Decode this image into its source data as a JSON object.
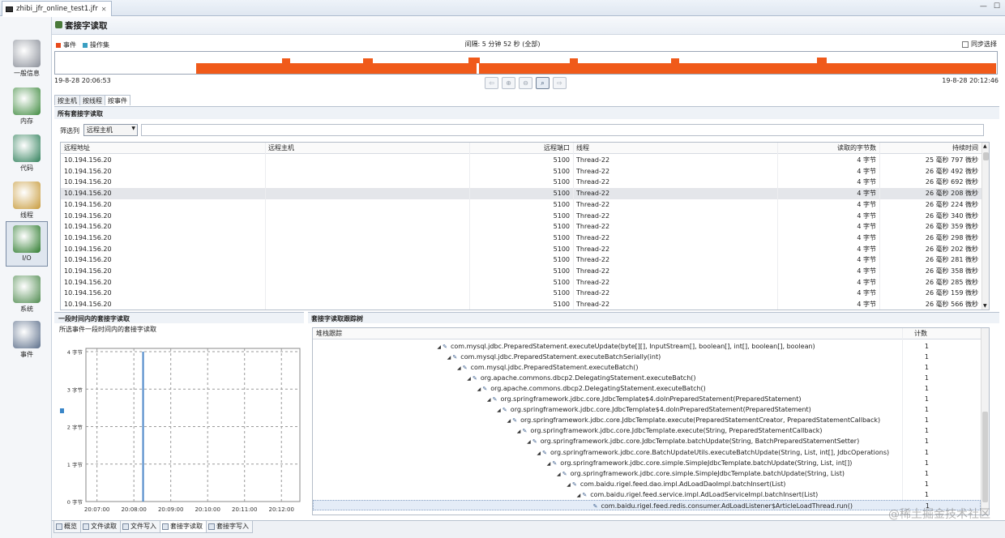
{
  "editor_tab": {
    "title": "zhibi_jfr_online_test1.jfr",
    "close": "✕"
  },
  "window_controls": {
    "minimize": "—",
    "maximize": "☐"
  },
  "sidenav": [
    {
      "label": "一般信息",
      "icon": "dashboard-icon"
    },
    {
      "label": "内存",
      "icon": "memory-chip-icon"
    },
    {
      "label": "代码",
      "icon": "code-icon"
    },
    {
      "label": "线程",
      "icon": "threads-gear-icon"
    },
    {
      "label": "I/O",
      "icon": "io-arrows-icon",
      "selected": true
    },
    {
      "label": "系统",
      "icon": "system-icon"
    },
    {
      "label": "事件",
      "icon": "events-icon"
    }
  ],
  "page": {
    "title": "套接字读取"
  },
  "timeline": {
    "legend": [
      {
        "label": "事件",
        "color": "#e84a1c"
      },
      {
        "label": "操作集",
        "color": "#3a9fc2"
      }
    ],
    "range_label": "间隔: 5 分钟 52 秒 (全部)",
    "sync_label": "同步选择",
    "start": "19-8-28 20:06:53",
    "end": "19-8-28 20:12:46",
    "activity_color": "#f05a1a"
  },
  "view_tabs": [
    "按主机",
    "按线程",
    "按事件"
  ],
  "events_section": {
    "title": "所有套接字读取",
    "filter_label": "筛选列",
    "filter_value": "远程主机",
    "columns": [
      "远程地址",
      "远程主机",
      "远程端口",
      "线程",
      "读取的字节数",
      "持续时间"
    ],
    "rows": [
      [
        "10.194.156.20",
        "",
        "5100",
        "Thread-22",
        "4 字节",
        "25 毫秒 797 微秒"
      ],
      [
        "10.194.156.20",
        "",
        "5100",
        "Thread-22",
        "4 字节",
        "26 毫秒 492 微秒"
      ],
      [
        "10.194.156.20",
        "",
        "5100",
        "Thread-22",
        "4 字节",
        "26 毫秒 692 微秒"
      ],
      [
        "10.194.156.20",
        "",
        "5100",
        "Thread-22",
        "4 字节",
        "26 毫秒 208 微秒"
      ],
      [
        "10.194.156.20",
        "",
        "5100",
        "Thread-22",
        "4 字节",
        "26 毫秒 224 微秒"
      ],
      [
        "10.194.156.20",
        "",
        "5100",
        "Thread-22",
        "4 字节",
        "26 毫秒 340 微秒"
      ],
      [
        "10.194.156.20",
        "",
        "5100",
        "Thread-22",
        "4 字节",
        "26 毫秒 359 微秒"
      ],
      [
        "10.194.156.20",
        "",
        "5100",
        "Thread-22",
        "4 字节",
        "26 毫秒 298 微秒"
      ],
      [
        "10.194.156.20",
        "",
        "5100",
        "Thread-22",
        "4 字节",
        "26 毫秒 202 微秒"
      ],
      [
        "10.194.156.20",
        "",
        "5100",
        "Thread-22",
        "4 字节",
        "26 毫秒 281 微秒"
      ],
      [
        "10.194.156.20",
        "",
        "5100",
        "Thread-22",
        "4 字节",
        "26 毫秒 358 微秒"
      ],
      [
        "10.194.156.20",
        "",
        "5100",
        "Thread-22",
        "4 字节",
        "26 毫秒 285 微秒"
      ],
      [
        "10.194.156.20",
        "",
        "5100",
        "Thread-22",
        "4 字节",
        "26 毫秒 159 微秒"
      ],
      [
        "10.194.156.20",
        "",
        "5100",
        "Thread-22",
        "4 字节",
        "26 毫秒 566 微秒"
      ]
    ],
    "selected_row": 3
  },
  "chart_section": {
    "title": "一段时间内的套接字读取",
    "subtitle": "所选事件一段时间内的套接字读取"
  },
  "chart_data": {
    "type": "bar",
    "title": "",
    "xlabel": "",
    "ylabel": "",
    "y_ticks": [
      "0 字节",
      "1 字节",
      "2 字节",
      "3 字节",
      "4 字节"
    ],
    "x_ticks": [
      "20:07:00",
      "20:08:00",
      "20:09:00",
      "20:10:00",
      "20:11:00",
      "20:12:00"
    ],
    "ylim": [
      0,
      4
    ],
    "series": [
      {
        "color": "#4a86c8",
        "x": [
          "20:08:15"
        ],
        "values": [
          4
        ]
      }
    ],
    "legend_marker_color": "#3a86c8",
    "grid": true
  },
  "tree_section": {
    "title": "套接字读取跟踪树",
    "columns": [
      "堆栈跟踪",
      "计数"
    ],
    "rows": [
      {
        "depth": 0,
        "text": "com.mysql.jdbc.PreparedStatement.executeUpdate(byte[][], InputStream[], boolean[], int[], boolean[], boolean)",
        "count": "1"
      },
      {
        "depth": 1,
        "text": "com.mysql.jdbc.PreparedStatement.executeBatchSerially(int)",
        "count": "1"
      },
      {
        "depth": 2,
        "text": "com.mysql.jdbc.PreparedStatement.executeBatch()",
        "count": "1"
      },
      {
        "depth": 3,
        "text": "org.apache.commons.dbcp2.DelegatingStatement.executeBatch()",
        "count": "1"
      },
      {
        "depth": 4,
        "text": "org.apache.commons.dbcp2.DelegatingStatement.executeBatch()",
        "count": "1"
      },
      {
        "depth": 5,
        "text": "org.springframework.jdbc.core.JdbcTemplate$4.doInPreparedStatement(PreparedStatement)",
        "count": "1"
      },
      {
        "depth": 6,
        "text": "org.springframework.jdbc.core.JdbcTemplate$4.doInPreparedStatement(PreparedStatement)",
        "count": "1"
      },
      {
        "depth": 7,
        "text": "org.springframework.jdbc.core.JdbcTemplate.execute(PreparedStatementCreator, PreparedStatementCallback)",
        "count": "1"
      },
      {
        "depth": 8,
        "text": "org.springframework.jdbc.core.JdbcTemplate.execute(String, PreparedStatementCallback)",
        "count": "1"
      },
      {
        "depth": 9,
        "text": "org.springframework.jdbc.core.JdbcTemplate.batchUpdate(String, BatchPreparedStatementSetter)",
        "count": "1"
      },
      {
        "depth": 10,
        "text": "org.springframework.jdbc.core.BatchUpdateUtils.executeBatchUpdate(String, List, int[], JdbcOperations)",
        "count": "1"
      },
      {
        "depth": 11,
        "text": "org.springframework.jdbc.core.simple.SimpleJdbcTemplate.batchUpdate(String, List, int[])",
        "count": "1"
      },
      {
        "depth": 12,
        "text": "org.springframework.jdbc.core.simple.SimpleJdbcTemplate.batchUpdate(String, List)",
        "count": "1"
      },
      {
        "depth": 13,
        "text": "com.baidu.rigel.feed.dao.impl.AdLoadDaoImpl.batchInsert(List)",
        "count": "1"
      },
      {
        "depth": 14,
        "text": "com.baidu.rigel.feed.service.impl.AdLoadServiceImpl.batchInsert(List)",
        "count": "1"
      },
      {
        "depth": 15,
        "text": "com.baidu.rigel.feed.redis.consumer.AdLoadListener$ArticleLoadThread.run()",
        "count": "1",
        "selected": true
      }
    ]
  },
  "page_tabs": [
    {
      "label": "概览"
    },
    {
      "label": "文件读取"
    },
    {
      "label": "文件写入"
    },
    {
      "label": "套接字读取",
      "selected": true
    },
    {
      "label": "套接字写入"
    }
  ],
  "watermark": "@稀土掘金技术社区"
}
